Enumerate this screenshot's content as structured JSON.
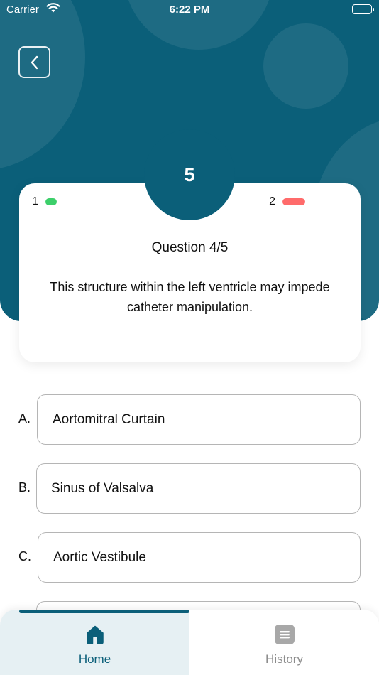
{
  "status_bar": {
    "carrier": "Carrier",
    "time": "6:22 PM"
  },
  "quiz": {
    "remaining_count": "5",
    "correct_count": "1",
    "wrong_count": "2",
    "question_label": "Question 4/5",
    "question_text": "This structure within the left ventricle may impede catheter manipulation."
  },
  "options": [
    {
      "letter": "A.",
      "text": "Aortomitral Curtain"
    },
    {
      "letter": "B.",
      "text": "Sinus of Valsalva"
    },
    {
      "letter": "C.",
      "text": "Aortic Vestibule"
    }
  ],
  "tabs": {
    "home": "Home",
    "history": "History"
  },
  "colors": {
    "primary": "#0b5f79",
    "correct": "#3ccf6a",
    "wrong": "#ff6b6b"
  }
}
